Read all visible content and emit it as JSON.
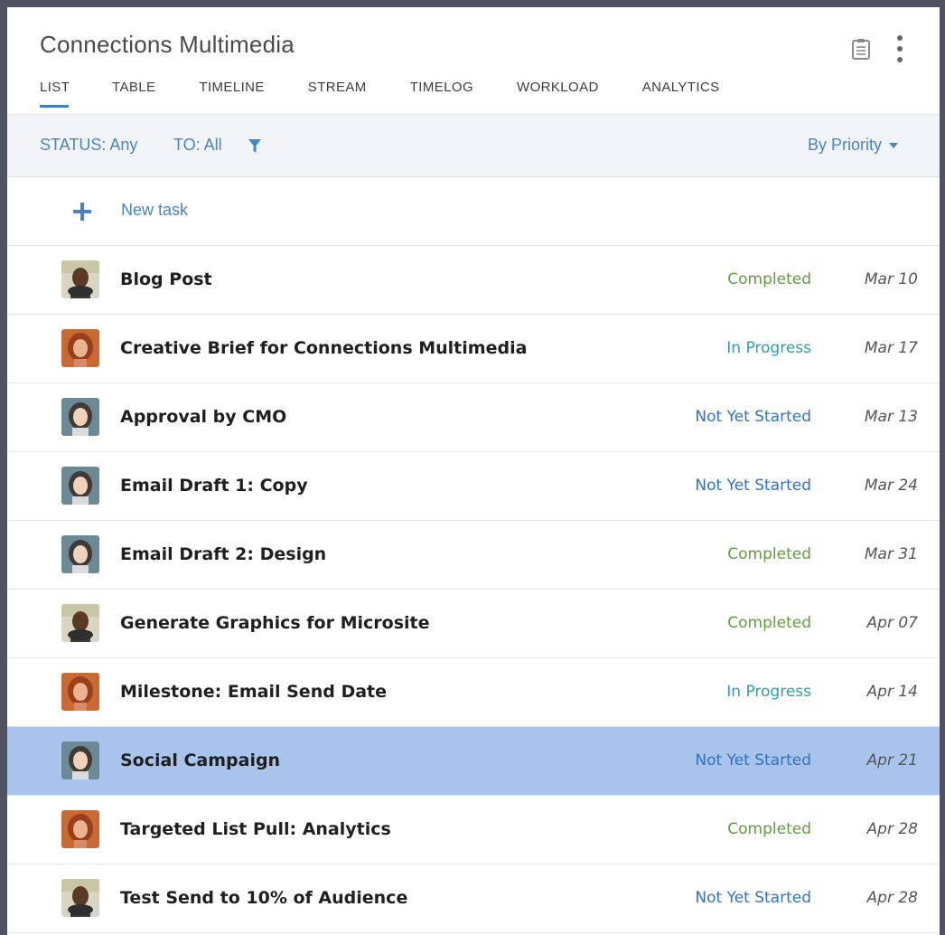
{
  "header": {
    "title": "Connections Multimedia",
    "tabs": [
      {
        "label": "LIST",
        "active": true
      },
      {
        "label": "TABLE"
      },
      {
        "label": "TIMELINE"
      },
      {
        "label": "STREAM"
      },
      {
        "label": "TIMELOG"
      },
      {
        "label": "WORKLOAD"
      },
      {
        "label": "ANALYTICS"
      }
    ],
    "icons": [
      "clipboard-icon",
      "more-vertical-icon"
    ]
  },
  "filters": {
    "status": "STATUS: Any",
    "to": "TO: All",
    "sort": "By Priority"
  },
  "new_task": {
    "label": "New task"
  },
  "tasks": [
    {
      "name": "Blog Post",
      "status": "Completed",
      "date": "Mar 10",
      "avatar": "man"
    },
    {
      "name": "Creative Brief for Connections Multimedia",
      "status": "In Progress",
      "date": "Mar 17",
      "avatar": "woman-red"
    },
    {
      "name": "Approval by CMO",
      "status": "Not Yet Started",
      "date": "Mar 13",
      "avatar": "woman-light"
    },
    {
      "name": "Email Draft 1: Copy",
      "status": "Not Yet Started",
      "date": "Mar 24",
      "avatar": "woman-light"
    },
    {
      "name": "Email Draft 2: Design",
      "status": "Completed",
      "date": "Mar 31",
      "avatar": "woman-light"
    },
    {
      "name": "Generate Graphics for Microsite",
      "status": "Completed",
      "date": "Apr 07",
      "avatar": "man"
    },
    {
      "name": "Milestone: Email Send Date",
      "status": "In Progress",
      "date": "Apr 14",
      "avatar": "woman-red"
    },
    {
      "name": "Social Campaign",
      "status": "Not Yet Started",
      "date": "Apr 21",
      "avatar": "woman-light",
      "selected": true
    },
    {
      "name": "Targeted List Pull: Analytics",
      "status": "Completed",
      "date": "Apr 28",
      "avatar": "woman-red"
    },
    {
      "name": "Test Send to 10% of Audience",
      "status": "Not Yet Started",
      "date": "Apr 28",
      "avatar": "man"
    }
  ],
  "colors": {
    "accent": "#4a83bf",
    "completed": "#5f9e3b",
    "in_progress": "#2a9fa8",
    "not_started": "#2e72c6",
    "selected_row": "#a9c4ec"
  }
}
